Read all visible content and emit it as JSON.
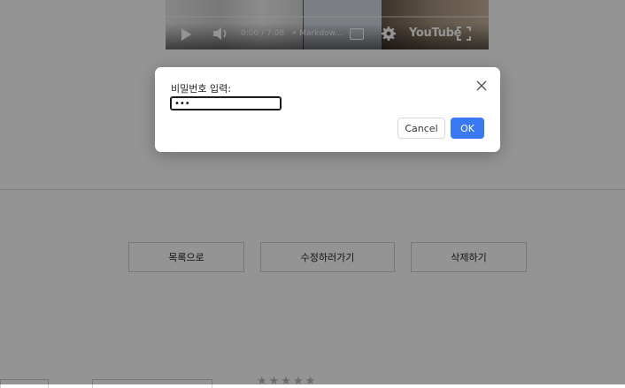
{
  "video": {
    "time": "0:00 / 7:08",
    "chapter": "• Markdow...",
    "brand": "YouTube"
  },
  "page": {
    "buttons": {
      "list": "목록으로",
      "edit": "수정하러가기",
      "delete": "삭제하기"
    },
    "stars": "★★★★★"
  },
  "dialog": {
    "label": "비밀번호 입력:",
    "password_value": "•••",
    "cancel_label": "Cancel",
    "ok_label": "OK"
  },
  "colors": {
    "ok_accent": "#3a79f4",
    "overlay": "rgba(0,0,0,0.42)"
  }
}
